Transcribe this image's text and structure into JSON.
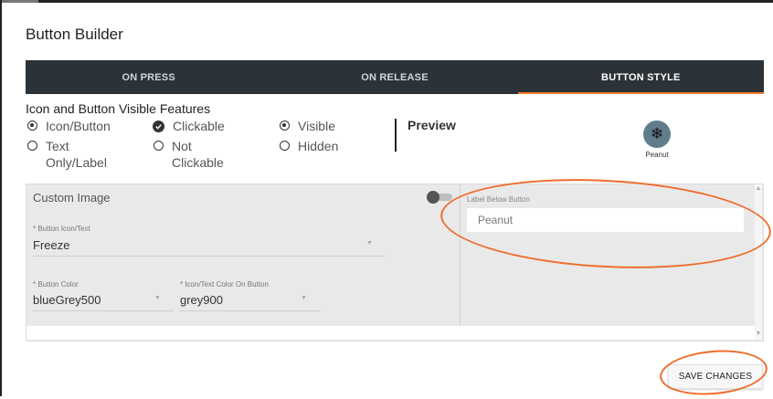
{
  "title": "Button Builder",
  "tabs": [
    {
      "label": "ON PRESS",
      "active": false
    },
    {
      "label": "ON RELEASE",
      "active": false
    },
    {
      "label": "BUTTON STYLE",
      "active": true
    }
  ],
  "features": {
    "title": "Icon and Button Visible Features",
    "groups": [
      {
        "options": [
          {
            "label": "Icon/Button",
            "selected": true,
            "type": "radio"
          },
          {
            "label": "Text Only/Label",
            "selected": false,
            "type": "radio"
          }
        ]
      },
      {
        "options": [
          {
            "label": "Clickable",
            "selected": true,
            "type": "check"
          },
          {
            "label": "Not Clickable",
            "selected": false,
            "type": "radio"
          }
        ]
      },
      {
        "options": [
          {
            "label": "Visible",
            "selected": true,
            "type": "radio"
          },
          {
            "label": "Hidden",
            "selected": false,
            "type": "radio"
          }
        ]
      }
    ]
  },
  "preview": {
    "label": "Preview",
    "icon": "snowflake-icon",
    "icon_glyph": "❄",
    "caption": "Peanut",
    "button_color": "#607d8b"
  },
  "form": {
    "custom_image_label": "Custom Image",
    "custom_image_toggle": false,
    "button_icon_text": {
      "label": "* Button Icon/Text",
      "value": "Freeze"
    },
    "button_color": {
      "label": "* Button Color",
      "value": "blueGrey500"
    },
    "icon_text_color": {
      "label": "* Icon/Text Color On Button",
      "value": "grey900"
    },
    "label_below_button": {
      "label": "Label Below Button",
      "value": "Peanut"
    }
  },
  "save_label": "SAVE CHANGES",
  "colors": {
    "tab_bar": "#2b3238",
    "tab_indicator": "#f47a2c",
    "annotation": "#ee6d2e"
  }
}
